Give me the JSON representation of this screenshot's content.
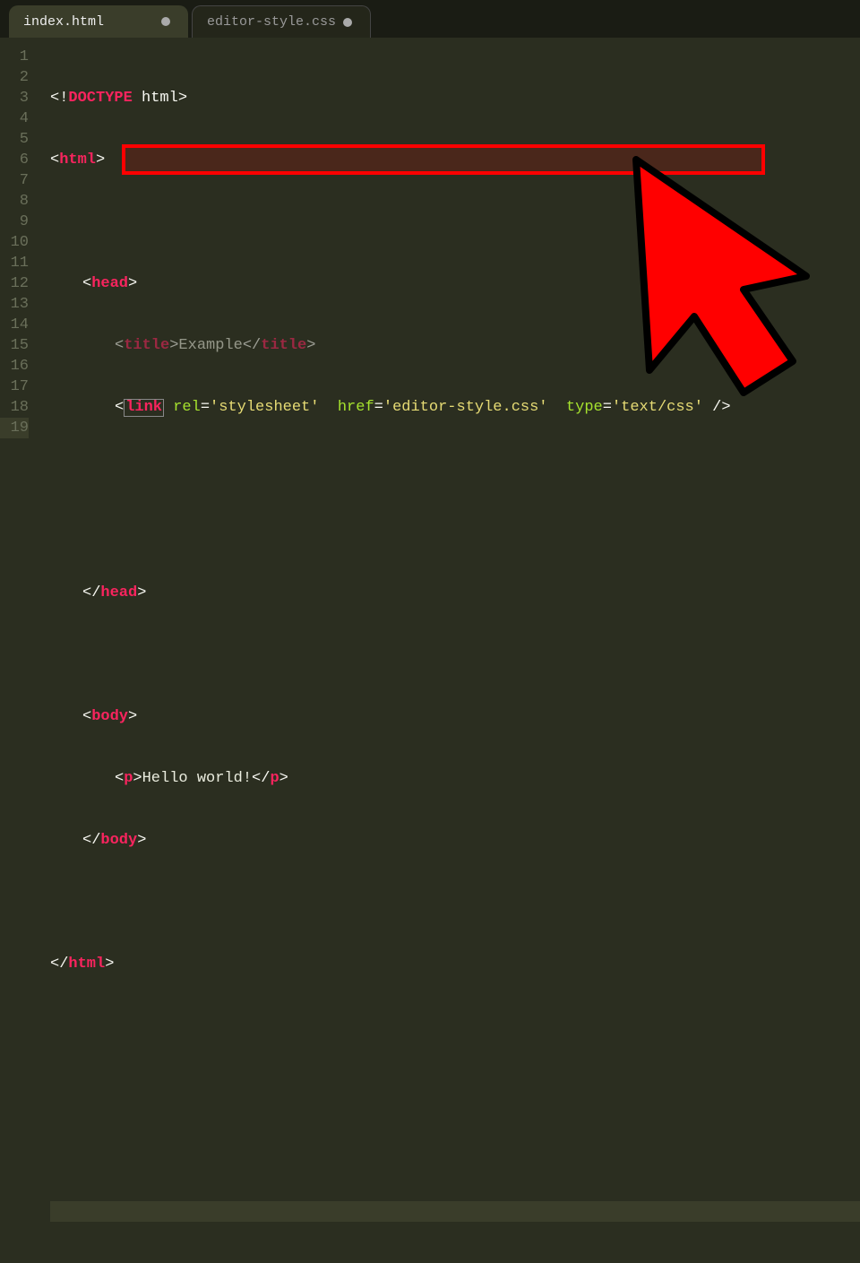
{
  "tabs": [
    {
      "label": "index.html",
      "active": true,
      "dirty": true
    },
    {
      "label": "editor-style.css",
      "active": false,
      "dirty": true
    }
  ],
  "gutter": {
    "lines": [
      "1",
      "2",
      "3",
      "4",
      "5",
      "6",
      "7",
      "8",
      "9",
      "10",
      "11",
      "12",
      "13",
      "14",
      "15",
      "16",
      "17",
      "18",
      "19"
    ],
    "current": 19
  },
  "code": {
    "line1": {
      "open": "<!",
      "doctype": "DOCTYPE",
      "rest": " html",
      "close": ">"
    },
    "line2": {
      "open": "<",
      "tag": "html",
      "close": ">"
    },
    "line4": {
      "open": "<",
      "tag": "head",
      "close": ">"
    },
    "line5": {
      "open": "<",
      "tag": "title",
      "close": ">",
      "text": "Example",
      "open2": "</",
      "tag2": "title",
      "close2": ">"
    },
    "line6": {
      "open": "<",
      "tag": "link",
      "sp": " ",
      "a1": "rel",
      "eq": "=",
      "v1": "'stylesheet'",
      "sp2": "  ",
      "a2": "href",
      "v2": "'editor-style.css'",
      "sp3": "  ",
      "a3": "type",
      "v3": "'text/css'",
      "end": " />"
    },
    "line9": {
      "open": "</",
      "tag": "head",
      "close": ">"
    },
    "line11": {
      "open": "<",
      "tag": "body",
      "close": ">"
    },
    "line12": {
      "open": "<",
      "tag": "p",
      "close": ">",
      "text": "Hello world!",
      "open2": "</",
      "tag2": "p",
      "close2": ">"
    },
    "line13": {
      "open": "</",
      "tag": "body",
      "close": ">"
    },
    "line15": {
      "open": "</",
      "tag": "html",
      "close": ">"
    }
  },
  "annotation": {
    "highlighted_line": 6,
    "cursor": "large-red-arrow"
  }
}
